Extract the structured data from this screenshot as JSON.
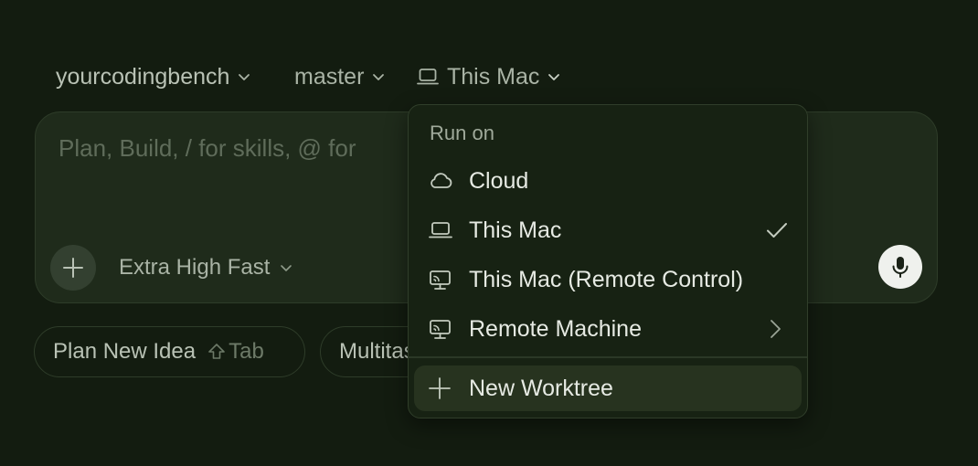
{
  "selectors": {
    "repo": "yourcodingbench",
    "branch": "master",
    "environment": "This Mac"
  },
  "composer": {
    "placeholder": "Plan, Build, / for skills, @ for",
    "model": "Extra High Fast"
  },
  "chips": [
    {
      "label": "Plan New Idea",
      "hint": "Tab"
    },
    {
      "label": "Multitask"
    }
  ],
  "dropdown": {
    "title": "Run on",
    "items": [
      {
        "label": "Cloud",
        "icon": "cloud-icon"
      },
      {
        "label": "This Mac",
        "icon": "laptop-icon",
        "selected": true
      },
      {
        "label": "This Mac (Remote Control)",
        "icon": "remote-desktop-icon"
      },
      {
        "label": "Remote Machine",
        "icon": "remote-desktop-icon",
        "submenu": true
      }
    ],
    "action": {
      "label": "New Worktree",
      "icon": "plus-icon"
    }
  },
  "colors": {
    "background": "#131c10",
    "composer": "#1f2b1b",
    "dropdown": "#172213",
    "text": "#e6eae3",
    "muted": "#a9b3a5"
  }
}
